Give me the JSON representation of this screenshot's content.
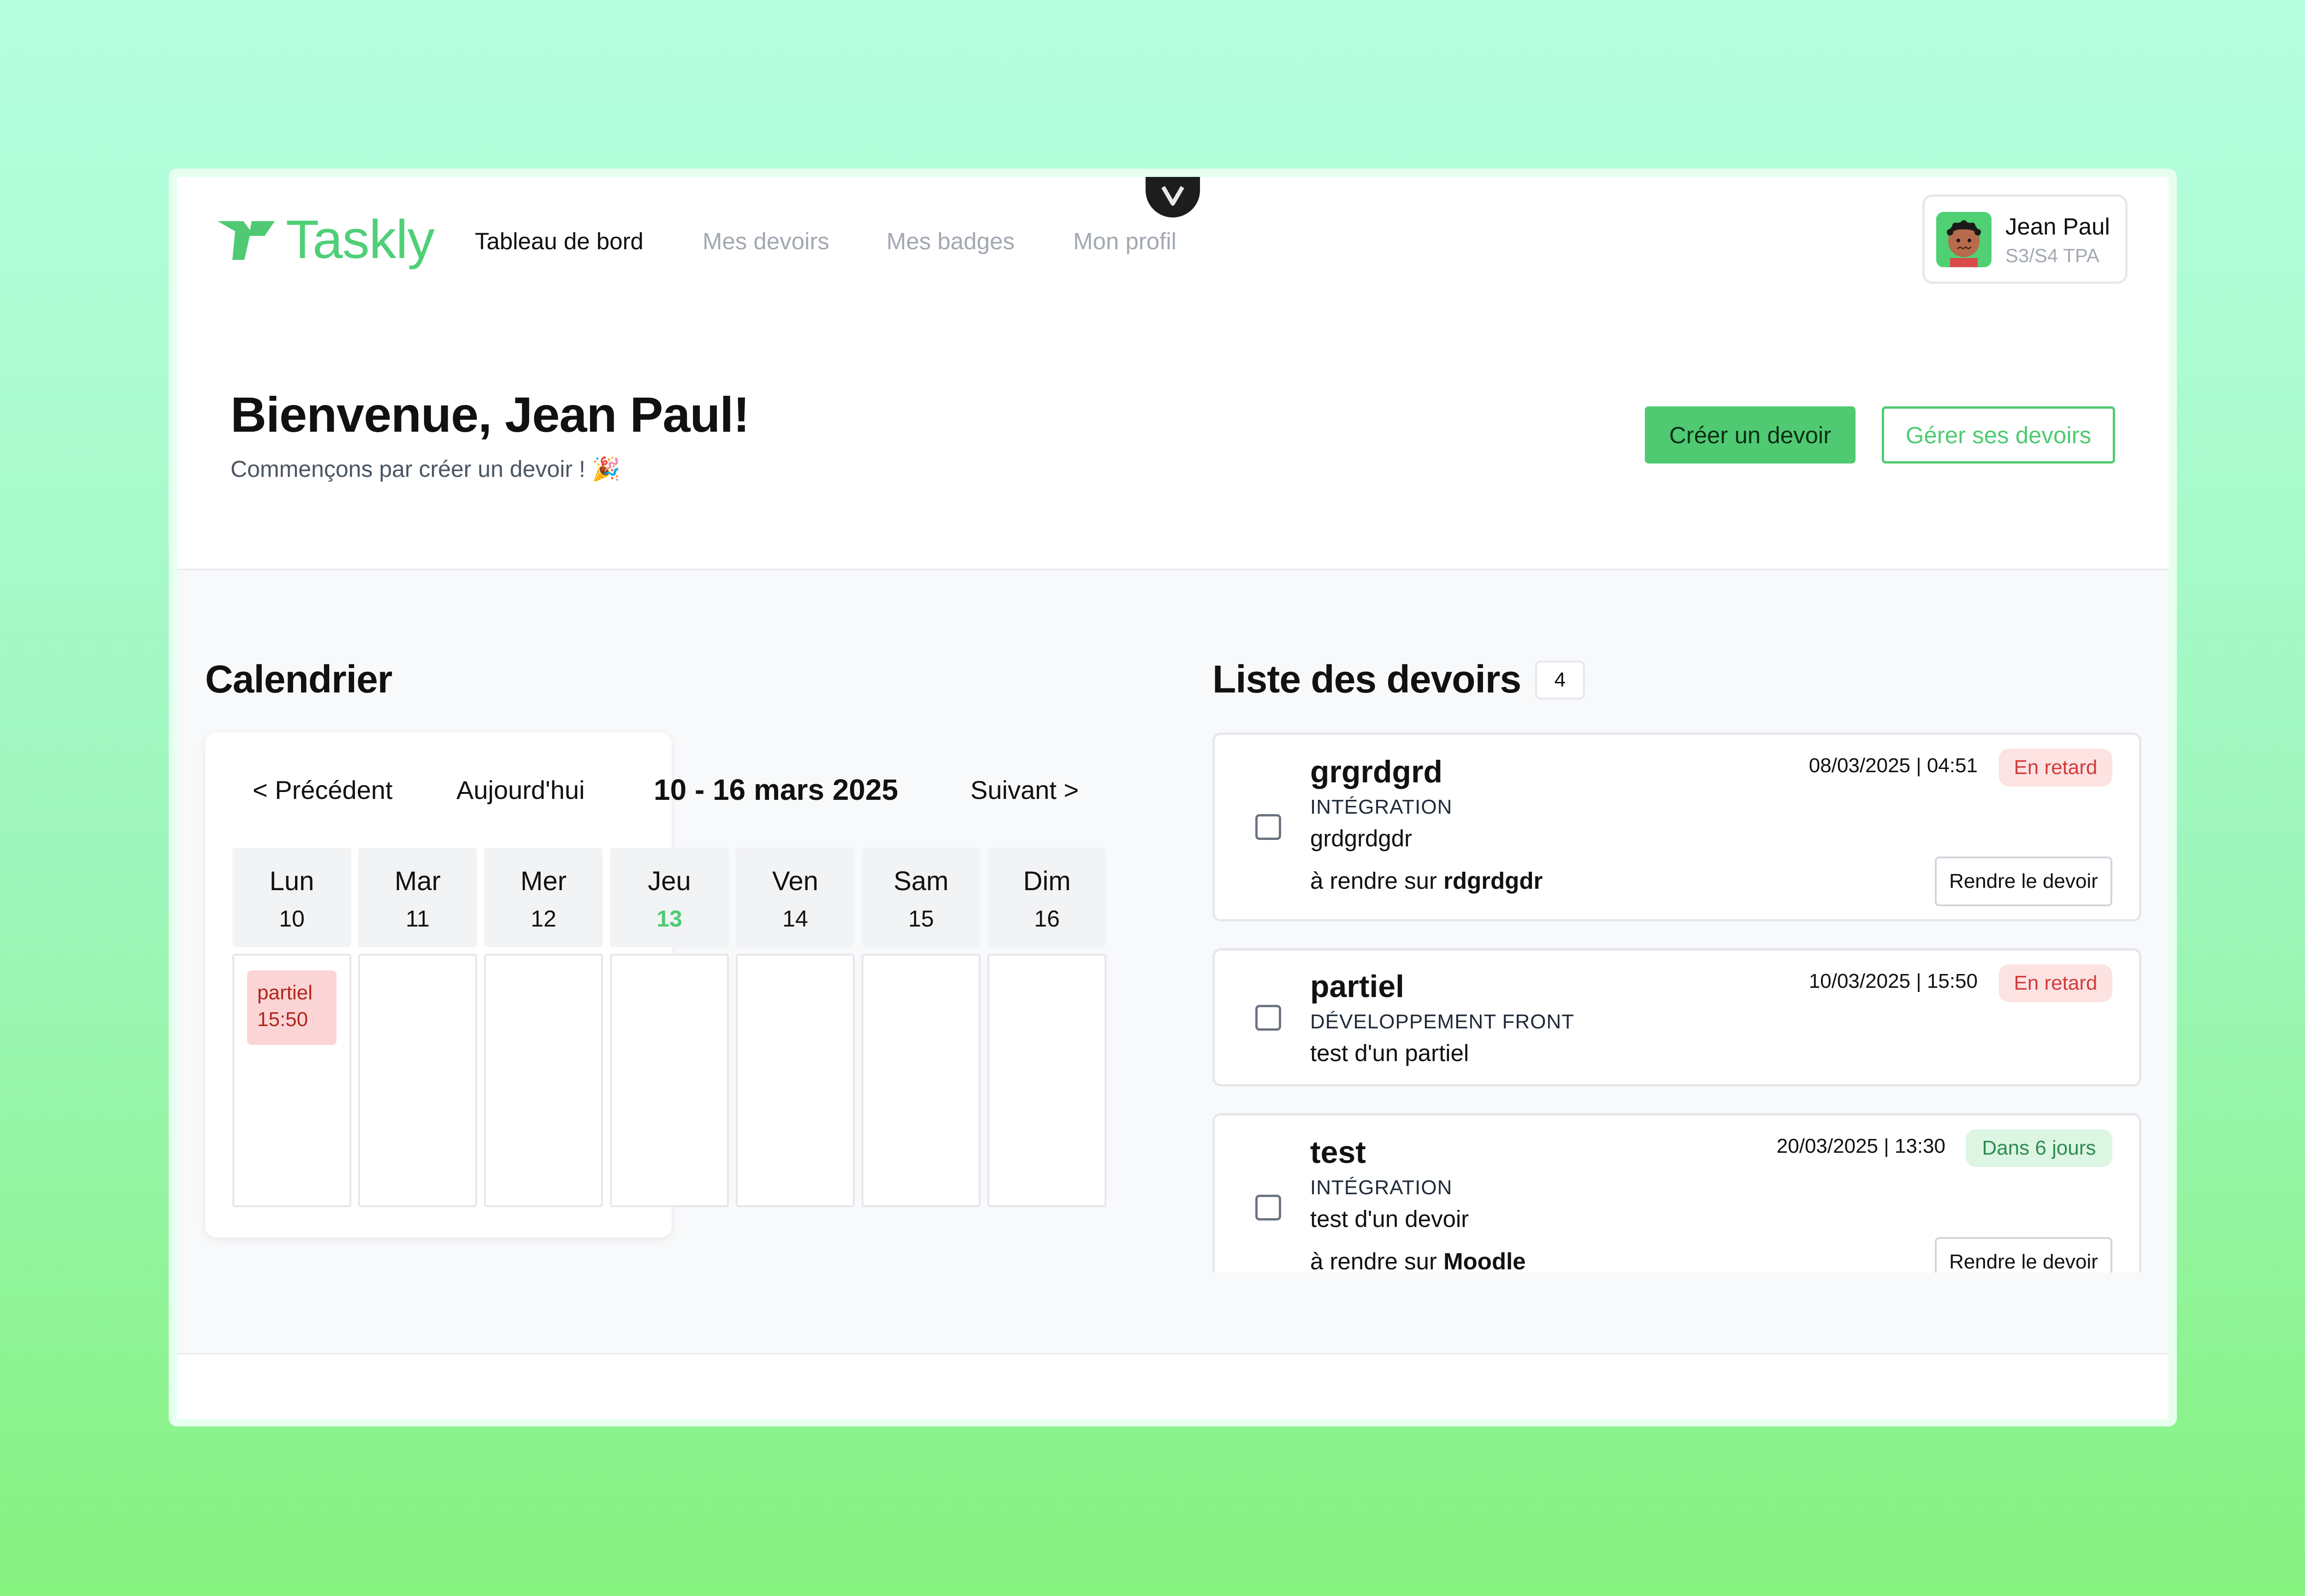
{
  "app": {
    "name": "Taskly",
    "brand_color": "#4fca72"
  },
  "nav": {
    "items": [
      {
        "label": "Tableau de bord",
        "active": true
      },
      {
        "label": "Mes devoirs",
        "active": false
      },
      {
        "label": "Mes badges",
        "active": false
      },
      {
        "label": "Mon profil",
        "active": false
      }
    ]
  },
  "user": {
    "name": "Jean Paul",
    "class": "S3/S4 TPA"
  },
  "welcome": {
    "title": "Bienvenue, Jean Paul!",
    "subtitle": "Commençons par créer un devoir ! 🎉",
    "create_label": "Créer un devoir",
    "manage_label": "Gérer ses devoirs"
  },
  "calendar": {
    "title": "Calendrier",
    "prev_label": "< Précédent",
    "today_label": "Aujourd'hui",
    "range": "10 - 16 mars 2025",
    "next_label": "Suivant >",
    "days": [
      {
        "name": "Lun",
        "num": "10",
        "today": false
      },
      {
        "name": "Mar",
        "num": "11",
        "today": false
      },
      {
        "name": "Mer",
        "num": "12",
        "today": false
      },
      {
        "name": "Jeu",
        "num": "13",
        "today": true
      },
      {
        "name": "Ven",
        "num": "14",
        "today": false
      },
      {
        "name": "Sam",
        "num": "15",
        "today": false
      },
      {
        "name": "Dim",
        "num": "16",
        "today": false
      }
    ],
    "events": [
      {
        "day": "Lun",
        "title": "partiel",
        "time": "15:50"
      }
    ]
  },
  "tasks": {
    "title": "Liste des devoirs",
    "count": "4",
    "submit_prefix": "à rendre sur",
    "items": [
      {
        "title": "grgrdgrd",
        "subject": "INTÉGRATION",
        "description": "grdgrdgdr",
        "date": "08/03/2025 | 04:51",
        "status": "En retard",
        "status_type": "late",
        "submit_on": "rdgrdgdr",
        "submit_button": "Rendre le devoir"
      },
      {
        "title": "partiel",
        "subject": "DÉVELOPPEMENT FRONT",
        "description": "test d'un partiel",
        "date": "10/03/2025 | 15:50",
        "status": "En retard",
        "status_type": "late"
      },
      {
        "title": "test",
        "subject": "INTÉGRATION",
        "description": "test d'un devoir",
        "date": "20/03/2025 | 13:30",
        "status": "Dans 6 jours",
        "status_type": "upcoming",
        "submit_on": "Moodle",
        "submit_button": "Rendre le devoir"
      }
    ]
  },
  "icons": {
    "logo": "taskly-logo-icon",
    "devtools": "chevron-down-icon",
    "avatar": "user-avatar-icon"
  }
}
